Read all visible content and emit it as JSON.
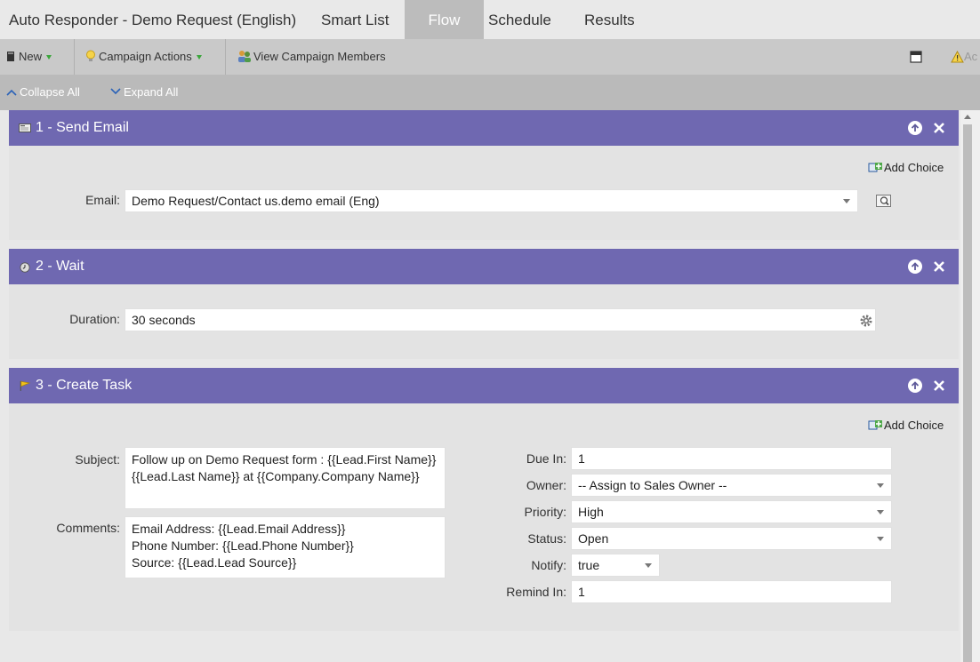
{
  "tabs": {
    "campaign_title": "Auto Responder - Demo Request (English)",
    "smart_list": "Smart List",
    "flow": "Flow",
    "schedule": "Schedule",
    "results": "Results"
  },
  "toolbar": {
    "new_label": "New",
    "campaign_actions_label": "Campaign Actions",
    "view_members_label": "View Campaign Members",
    "truncated_label": "Ac"
  },
  "collapse": {
    "collapse_all": "Collapse All",
    "expand_all": "Expand All"
  },
  "steps": [
    {
      "title": "1 - Send Email",
      "add_choice": "Add Choice",
      "email_label": "Email:",
      "email_value": "Demo Request/Contact us.demo email (Eng)"
    },
    {
      "title": "2 - Wait",
      "duration_label": "Duration:",
      "duration_value": "30 seconds"
    },
    {
      "title": "3 - Create Task",
      "add_choice": "Add Choice",
      "subject_label": "Subject:",
      "subject_value": "Follow up on Demo Request form : {{Lead.First Name}} {{Lead.Last Name}} at {{Company.Company Name}}",
      "comments_label": "Comments:",
      "comments_lines": [
        "Email Address: {{Lead.Email Address}}",
        "Phone Number: {{Lead.Phone Number}}",
        "Source: {{Lead.Lead Source}}"
      ],
      "due_in_label": "Due In:",
      "due_in_value": "1",
      "owner_label": "Owner:",
      "owner_value": "-- Assign to Sales Owner --",
      "priority_label": "Priority:",
      "priority_value": "High",
      "status_label": "Status:",
      "status_value": "Open",
      "notify_label": "Notify:",
      "notify_value": "true",
      "remind_in_label": "Remind In:",
      "remind_in_value": "1"
    }
  ],
  "colors": {
    "step_header": "#6f68b1",
    "active_tab": "#bcbcbc"
  }
}
